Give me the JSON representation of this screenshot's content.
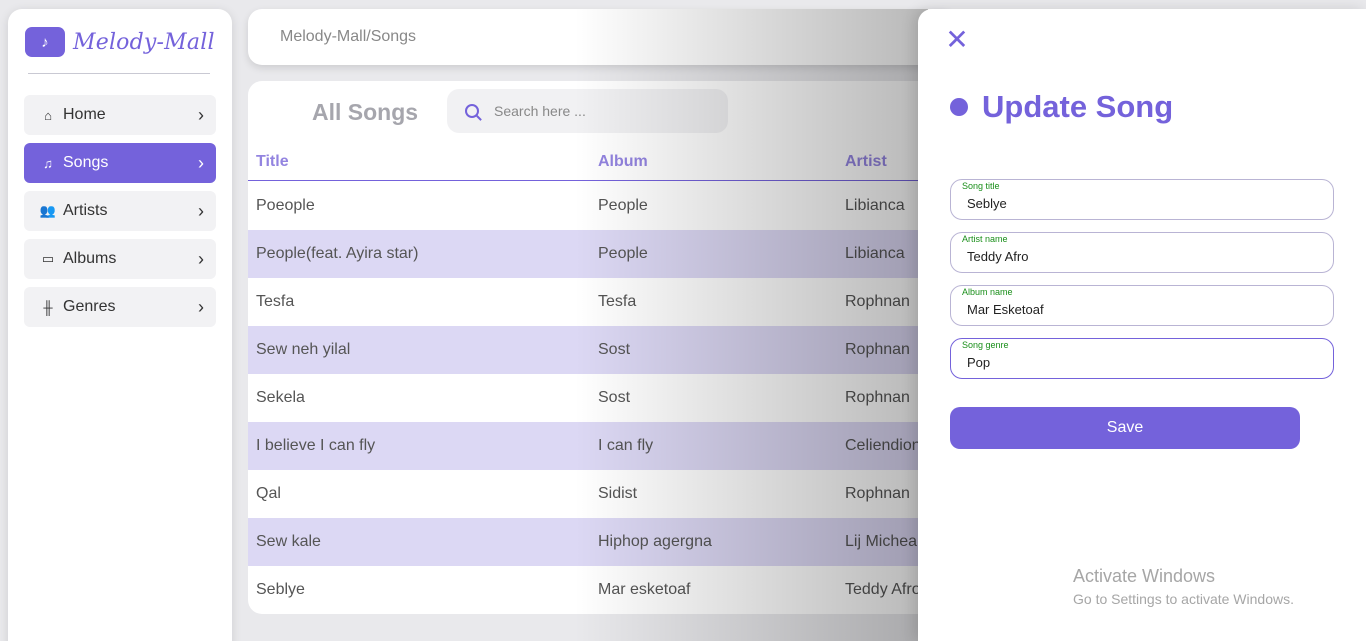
{
  "sidebar": {
    "logo_text": "Melody-Mall",
    "items": [
      {
        "label": "Home",
        "icon": "home-icon",
        "glyph": "⌂",
        "chevron": "›"
      },
      {
        "label": "Songs",
        "icon": "music-note-icon",
        "glyph": "♫",
        "chevron": "›",
        "active": true
      },
      {
        "label": "Artists",
        "icon": "users-icon",
        "glyph": "👥",
        "chevron": "›"
      },
      {
        "label": "Albums",
        "icon": "album-icon",
        "glyph": "▭",
        "chevron": "›"
      },
      {
        "label": "Genres",
        "icon": "waveform-icon",
        "glyph": "╫",
        "chevron": "›"
      }
    ]
  },
  "header": {
    "breadcrumb": "Melody-Mall/Songs"
  },
  "main": {
    "heading": "All Songs",
    "search_placeholder": "Search here ...",
    "columns": [
      "Title",
      "Album",
      "Artist"
    ],
    "rows": [
      [
        "Poeople",
        "People",
        "Libianca"
      ],
      [
        "People(feat. Ayira star)",
        "People",
        "Libianca"
      ],
      [
        "Tesfa",
        "Tesfa",
        "Rophnan"
      ],
      [
        "Sew neh yilal",
        "Sost",
        "Rophnan"
      ],
      [
        "Sekela",
        "Sost",
        "Rophnan"
      ],
      [
        "I believe I can fly",
        "I can fly",
        "Celiendion"
      ],
      [
        "Qal",
        "Sidist",
        "Rophnan"
      ],
      [
        "Sew kale",
        "Hiphop agergna",
        "Lij Michea"
      ],
      [
        "Seblye",
        "Mar esketoaf",
        "Teddy Afro"
      ]
    ]
  },
  "drawer": {
    "close_glyph": "✕",
    "title": "Update Song",
    "fields": [
      {
        "label": "Song title",
        "value": "Seblye"
      },
      {
        "label": "Artist name",
        "value": "Teddy Afro"
      },
      {
        "label": "Album name",
        "value": "Mar Esketoaf"
      },
      {
        "label": "Song genre",
        "value": "Pop"
      }
    ],
    "save_label": "Save"
  },
  "watermark": {
    "line1": "Activate Windows",
    "line2": "Go to Settings to activate Windows."
  },
  "colors": {
    "accent": "#7462db",
    "row_alt": "#dcd8f4",
    "label_green": "#1a8f1a"
  }
}
